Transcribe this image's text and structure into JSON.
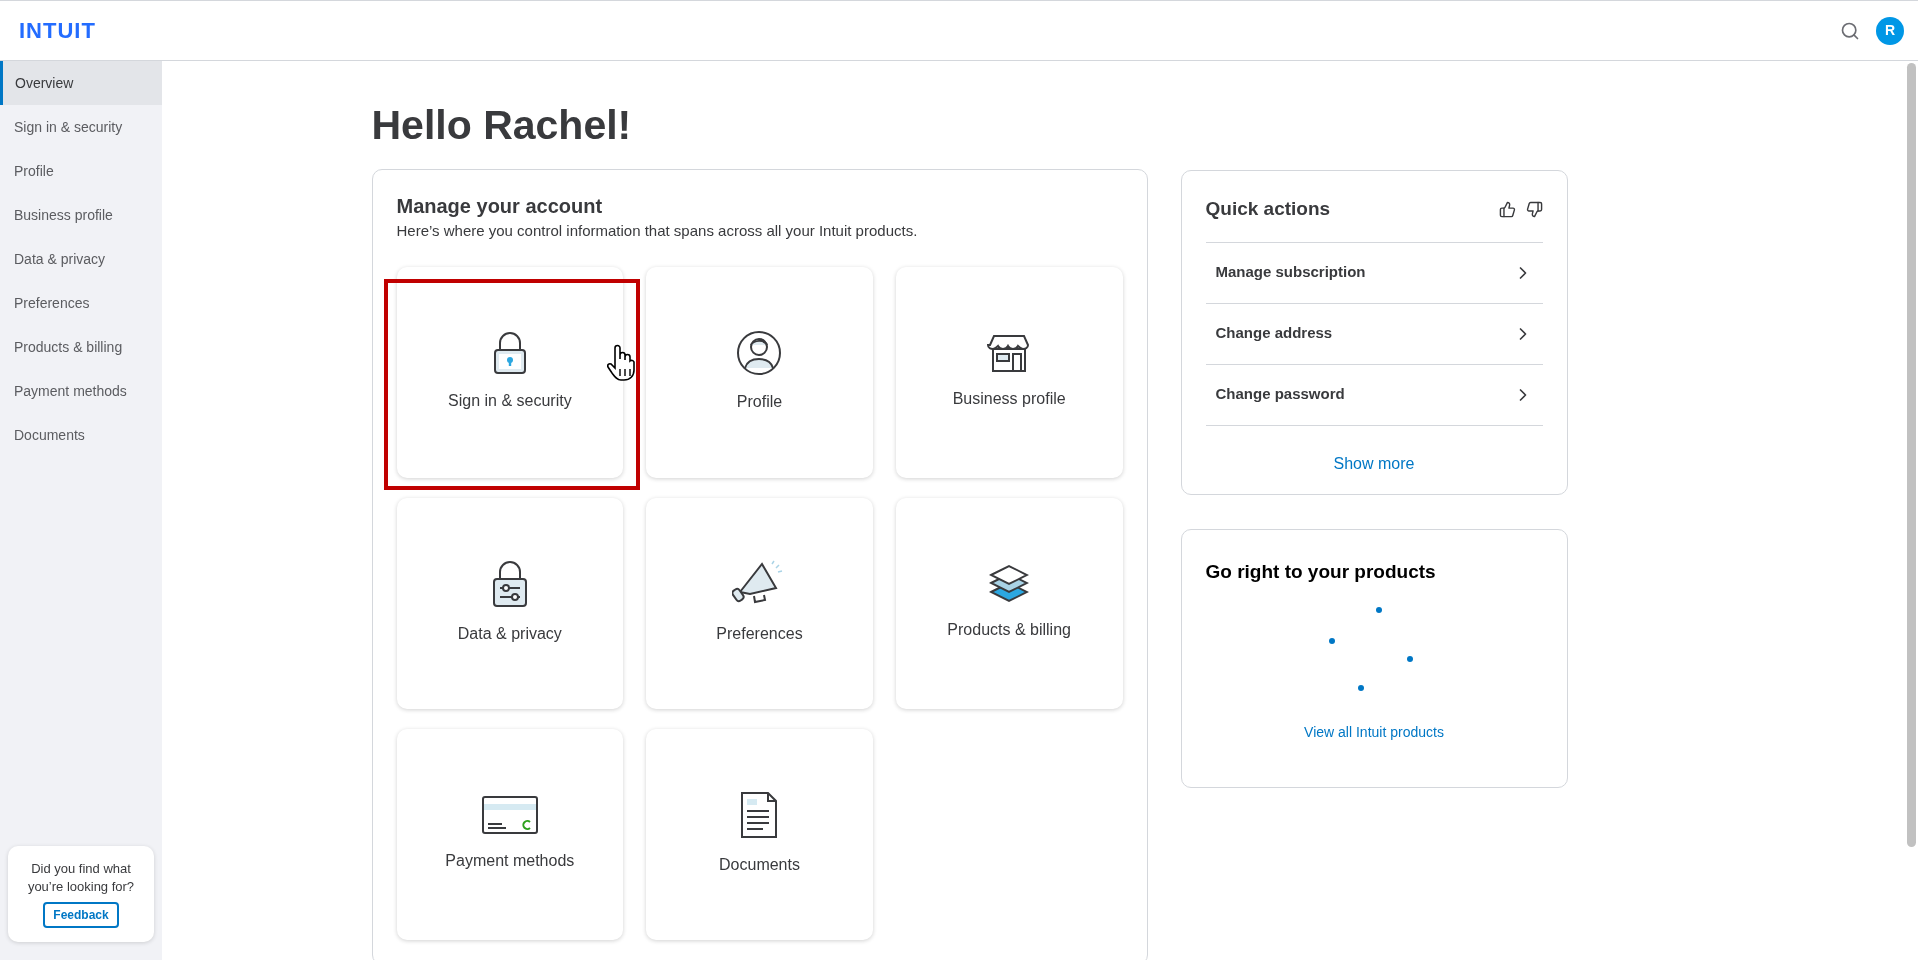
{
  "header": {
    "logo": "INTUIT",
    "avatar": "R"
  },
  "sidebar": {
    "items": [
      {
        "label": "Overview",
        "selected": true
      },
      {
        "label": "Sign in & security",
        "selected": false
      },
      {
        "label": "Profile",
        "selected": false
      },
      {
        "label": "Business profile",
        "selected": false
      },
      {
        "label": "Data & privacy",
        "selected": false
      },
      {
        "label": "Preferences",
        "selected": false
      },
      {
        "label": "Products & billing",
        "selected": false
      },
      {
        "label": "Payment methods",
        "selected": false
      },
      {
        "label": "Documents",
        "selected": false
      }
    ],
    "feedback": {
      "question": "Did you find what you’re looking for?",
      "button": "Feedback"
    }
  },
  "greeting": "Hello Rachel!",
  "manage": {
    "title": "Manage your account",
    "subtitle": "Here’s where you control information that spans across all your Intuit products.",
    "tiles": [
      {
        "label": "Sign in & security",
        "highlighted": true
      },
      {
        "label": "Profile",
        "highlighted": false
      },
      {
        "label": "Business profile",
        "highlighted": false
      },
      {
        "label": "Data & privacy",
        "highlighted": false
      },
      {
        "label": "Preferences",
        "highlighted": false
      },
      {
        "label": "Products & billing",
        "highlighted": false
      },
      {
        "label": "Payment methods",
        "highlighted": false
      },
      {
        "label": "Documents",
        "highlighted": false
      }
    ]
  },
  "quick_actions": {
    "title": "Quick actions",
    "items": [
      "Manage subscription",
      "Change address",
      "Change password"
    ],
    "show_more": "Show more"
  },
  "products": {
    "title": "Go right to your products",
    "link": "View all Intuit products"
  }
}
